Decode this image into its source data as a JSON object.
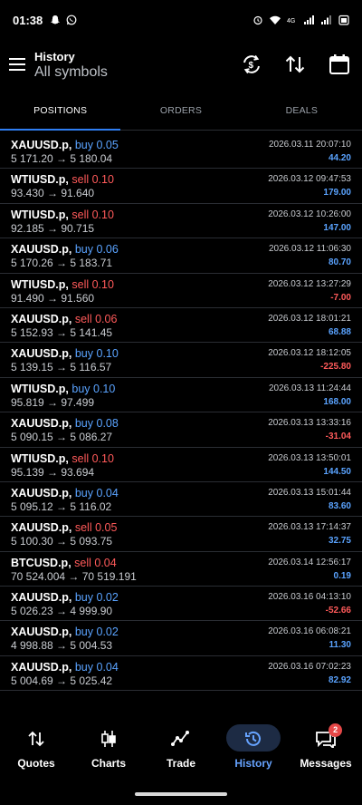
{
  "status": {
    "time": "01:38"
  },
  "header": {
    "title": "History",
    "subtitle": "All symbols"
  },
  "tabs": [
    {
      "label": "POSITIONS",
      "active": true
    },
    {
      "label": "ORDERS",
      "active": false
    },
    {
      "label": "DEALS",
      "active": false
    }
  ],
  "colors": {
    "buy": "#5aa3ff",
    "sell": "#ff5a5a",
    "profit_pos": "#5aa3ff",
    "profit_neg": "#ff5a5a",
    "accent": "#2f7ef2"
  },
  "deals": [
    {
      "symbol": "XAUUSD.p,",
      "side": "buy 0.05",
      "type": "buy",
      "prices": "5 171.20 → 5 180.04",
      "date": "2026.03.11 20:07:10",
      "profit": "44.20",
      "neg": false
    },
    {
      "symbol": "WTIUSD.p,",
      "side": "sell 0.10",
      "type": "sell",
      "prices": "93.430 → 91.640",
      "date": "2026.03.12 09:47:53",
      "profit": "179.00",
      "neg": false
    },
    {
      "symbol": "WTIUSD.p,",
      "side": "sell 0.10",
      "type": "sell",
      "prices": "92.185 → 90.715",
      "date": "2026.03.12 10:26:00",
      "profit": "147.00",
      "neg": false
    },
    {
      "symbol": "XAUUSD.p,",
      "side": "buy 0.06",
      "type": "buy",
      "prices": "5 170.26 → 5 183.71",
      "date": "2026.03.12 11:06:30",
      "profit": "80.70",
      "neg": false
    },
    {
      "symbol": "WTIUSD.p,",
      "side": "sell 0.10",
      "type": "sell",
      "prices": "91.490 → 91.560",
      "date": "2026.03.12 13:27:29",
      "profit": "-7.00",
      "neg": true
    },
    {
      "symbol": "XAUUSD.p,",
      "side": "sell 0.06",
      "type": "sell",
      "prices": "5 152.93 → 5 141.45",
      "date": "2026.03.12 18:01:21",
      "profit": "68.88",
      "neg": false
    },
    {
      "symbol": "XAUUSD.p,",
      "side": "buy 0.10",
      "type": "buy",
      "prices": "5 139.15 → 5 116.57",
      "date": "2026.03.12 18:12:05",
      "profit": "-225.80",
      "neg": true
    },
    {
      "symbol": "WTIUSD.p,",
      "side": "buy 0.10",
      "type": "buy",
      "prices": "95.819 → 97.499",
      "date": "2026.03.13 11:24:44",
      "profit": "168.00",
      "neg": false
    },
    {
      "symbol": "XAUUSD.p,",
      "side": "buy 0.08",
      "type": "buy",
      "prices": "5 090.15 → 5 086.27",
      "date": "2026.03.13 13:33:16",
      "profit": "-31.04",
      "neg": true
    },
    {
      "symbol": "WTIUSD.p,",
      "side": "sell 0.10",
      "type": "sell",
      "prices": "95.139 → 93.694",
      "date": "2026.03.13 13:50:01",
      "profit": "144.50",
      "neg": false
    },
    {
      "symbol": "XAUUSD.p,",
      "side": "buy 0.04",
      "type": "buy",
      "prices": "5 095.12 → 5 116.02",
      "date": "2026.03.13 15:01:44",
      "profit": "83.60",
      "neg": false
    },
    {
      "symbol": "XAUUSD.p,",
      "side": "sell 0.05",
      "type": "sell",
      "prices": "5 100.30 → 5 093.75",
      "date": "2026.03.13 17:14:37",
      "profit": "32.75",
      "neg": false
    },
    {
      "symbol": "BTCUSD.p,",
      "side": "sell 0.04",
      "type": "sell",
      "prices": "70 524.004 → 70 519.191",
      "date": "2026.03.14 12:56:17",
      "profit": "0.19",
      "neg": false
    },
    {
      "symbol": "XAUUSD.p,",
      "side": "buy 0.02",
      "type": "buy",
      "prices": "5 026.23 → 4 999.90",
      "date": "2026.03.16 04:13:10",
      "profit": "-52.66",
      "neg": true
    },
    {
      "symbol": "XAUUSD.p,",
      "side": "buy 0.02",
      "type": "buy",
      "prices": "4 998.88 → 5 004.53",
      "date": "2026.03.16 06:08:21",
      "profit": "11.30",
      "neg": false
    },
    {
      "symbol": "XAUUSD.p,",
      "side": "buy 0.04",
      "type": "buy",
      "prices": "5 004.69 → 5 025.42",
      "date": "2026.03.16 07:02:23",
      "profit": "82.92",
      "neg": false
    }
  ],
  "nav": [
    {
      "label": "Quotes",
      "icon": "quotes-arrows-icon"
    },
    {
      "label": "Charts",
      "icon": "candlestick-icon"
    },
    {
      "label": "Trade",
      "icon": "trade-line-icon"
    },
    {
      "label": "History",
      "icon": "history-clock-icon",
      "active": true
    },
    {
      "label": "Messages",
      "icon": "messages-icon",
      "badge": "2"
    }
  ]
}
